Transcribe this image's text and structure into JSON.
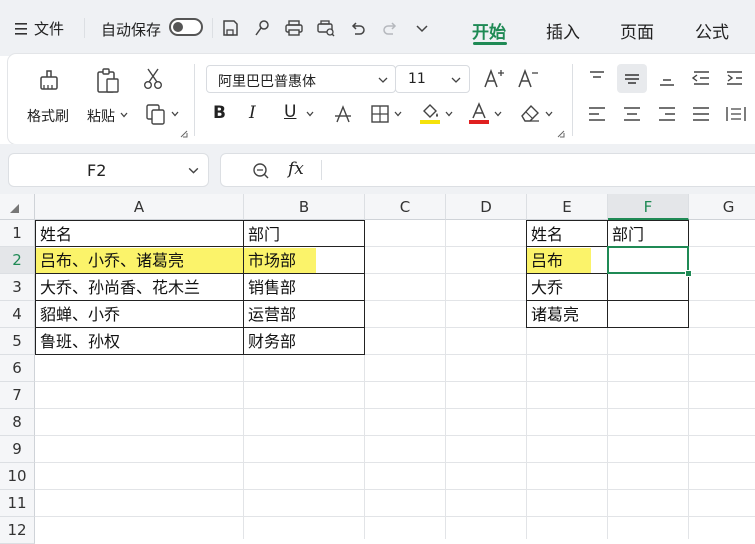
{
  "topbar": {
    "menu_label": "文件",
    "autosave_label": "自动保存",
    "tabs": [
      {
        "label": "开始",
        "active": true
      },
      {
        "label": "插入",
        "active": false
      },
      {
        "label": "页面",
        "active": false
      },
      {
        "label": "公式",
        "active": false
      }
    ]
  },
  "ribbon": {
    "format_painter": "格式刷",
    "paste": "粘贴",
    "font_name": "阿里巴巴普惠体",
    "font_size": "11",
    "bold": "B",
    "italic": "I",
    "underline": "U"
  },
  "formula_bar": {
    "name_box": "F2",
    "fx": "fx",
    "value": ""
  },
  "grid": {
    "columns": [
      "A",
      "B",
      "C",
      "D",
      "E",
      "F",
      "G"
    ],
    "rows": [
      "1",
      "2",
      "3",
      "4",
      "5",
      "6",
      "7",
      "8",
      "9",
      "10",
      "11",
      "12"
    ],
    "selected_cell": "F2",
    "cells": {
      "A1": "姓名",
      "B1": "部门",
      "A2": "吕布、小乔、诸葛亮",
      "B2": "市场部",
      "A3": "大乔、孙尚香、花木兰",
      "B3": "销售部",
      "A4": "貂蝉、小乔",
      "B4": "运营部",
      "A5": "鲁班、孙权",
      "B5": "财务部",
      "E1": "姓名",
      "F1": "部门",
      "E2": "吕布",
      "E3": "大乔",
      "E4": "诸葛亮"
    }
  },
  "colors": {
    "accent": "#1f8a55",
    "highlight": "#fbf36a",
    "font_color_underline": "#e02020"
  }
}
